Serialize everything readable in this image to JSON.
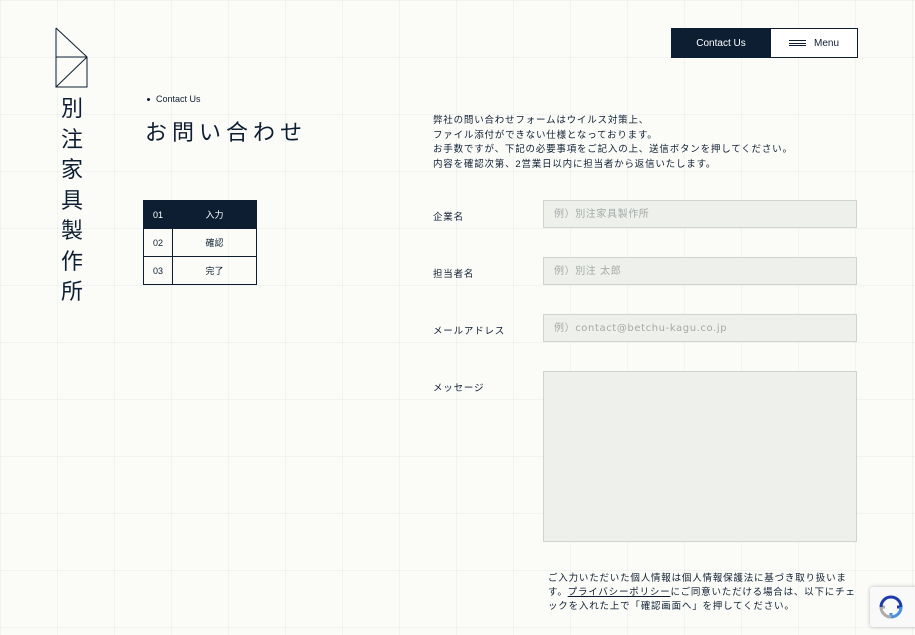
{
  "brand": {
    "name_chars": [
      "別",
      "注",
      "家",
      "具",
      "製",
      "作",
      "所"
    ]
  },
  "header": {
    "contact_label": "Contact Us",
    "menu_label": "Menu"
  },
  "breadcrumb": {
    "current": "Contact Us"
  },
  "page": {
    "title": "お問い合わせ"
  },
  "steps": [
    {
      "num": "01",
      "label": "入力",
      "active": true
    },
    {
      "num": "02",
      "label": "確認",
      "active": false
    },
    {
      "num": "03",
      "label": "完了",
      "active": false
    }
  ],
  "intro": {
    "lines": [
      "弊社の問い合わせフォームはウイルス対策上、",
      "ファイル添付ができない仕様となっております。",
      "お手数ですが、下記の必要事項をご記入の上、送信ボタンを押してください。",
      "内容を確認次第、2営業日以内に担当者から返信いたします。"
    ]
  },
  "form": {
    "company": {
      "label": "企業名",
      "placeholder": "例）別注家具製作所",
      "value": ""
    },
    "person": {
      "label": "担当者名",
      "placeholder": "例）別注 太郎",
      "value": ""
    },
    "email": {
      "label": "メールアドレス",
      "placeholder": "例）contact@betchu-kagu.co.jp",
      "value": ""
    },
    "message": {
      "label": "メッセージ",
      "value": ""
    }
  },
  "privacy": {
    "before": "ご入力いただいた個人情報は個人情報保護法に基づき取り扱います。",
    "link": "プライバシーポリシー",
    "after": "にご同意いただける場合は、以下にチェックを入れた上で「確認画面へ」を押してください。"
  },
  "colors": {
    "navy": "#0e1e32",
    "background": "#fbfcf8",
    "input_bg": "#eef0ec",
    "input_border": "#d0d4cf"
  },
  "icons": {
    "logo": "logo-triangle-icon",
    "menu": "hamburger-icon",
    "recaptcha": "recaptcha-icon"
  }
}
